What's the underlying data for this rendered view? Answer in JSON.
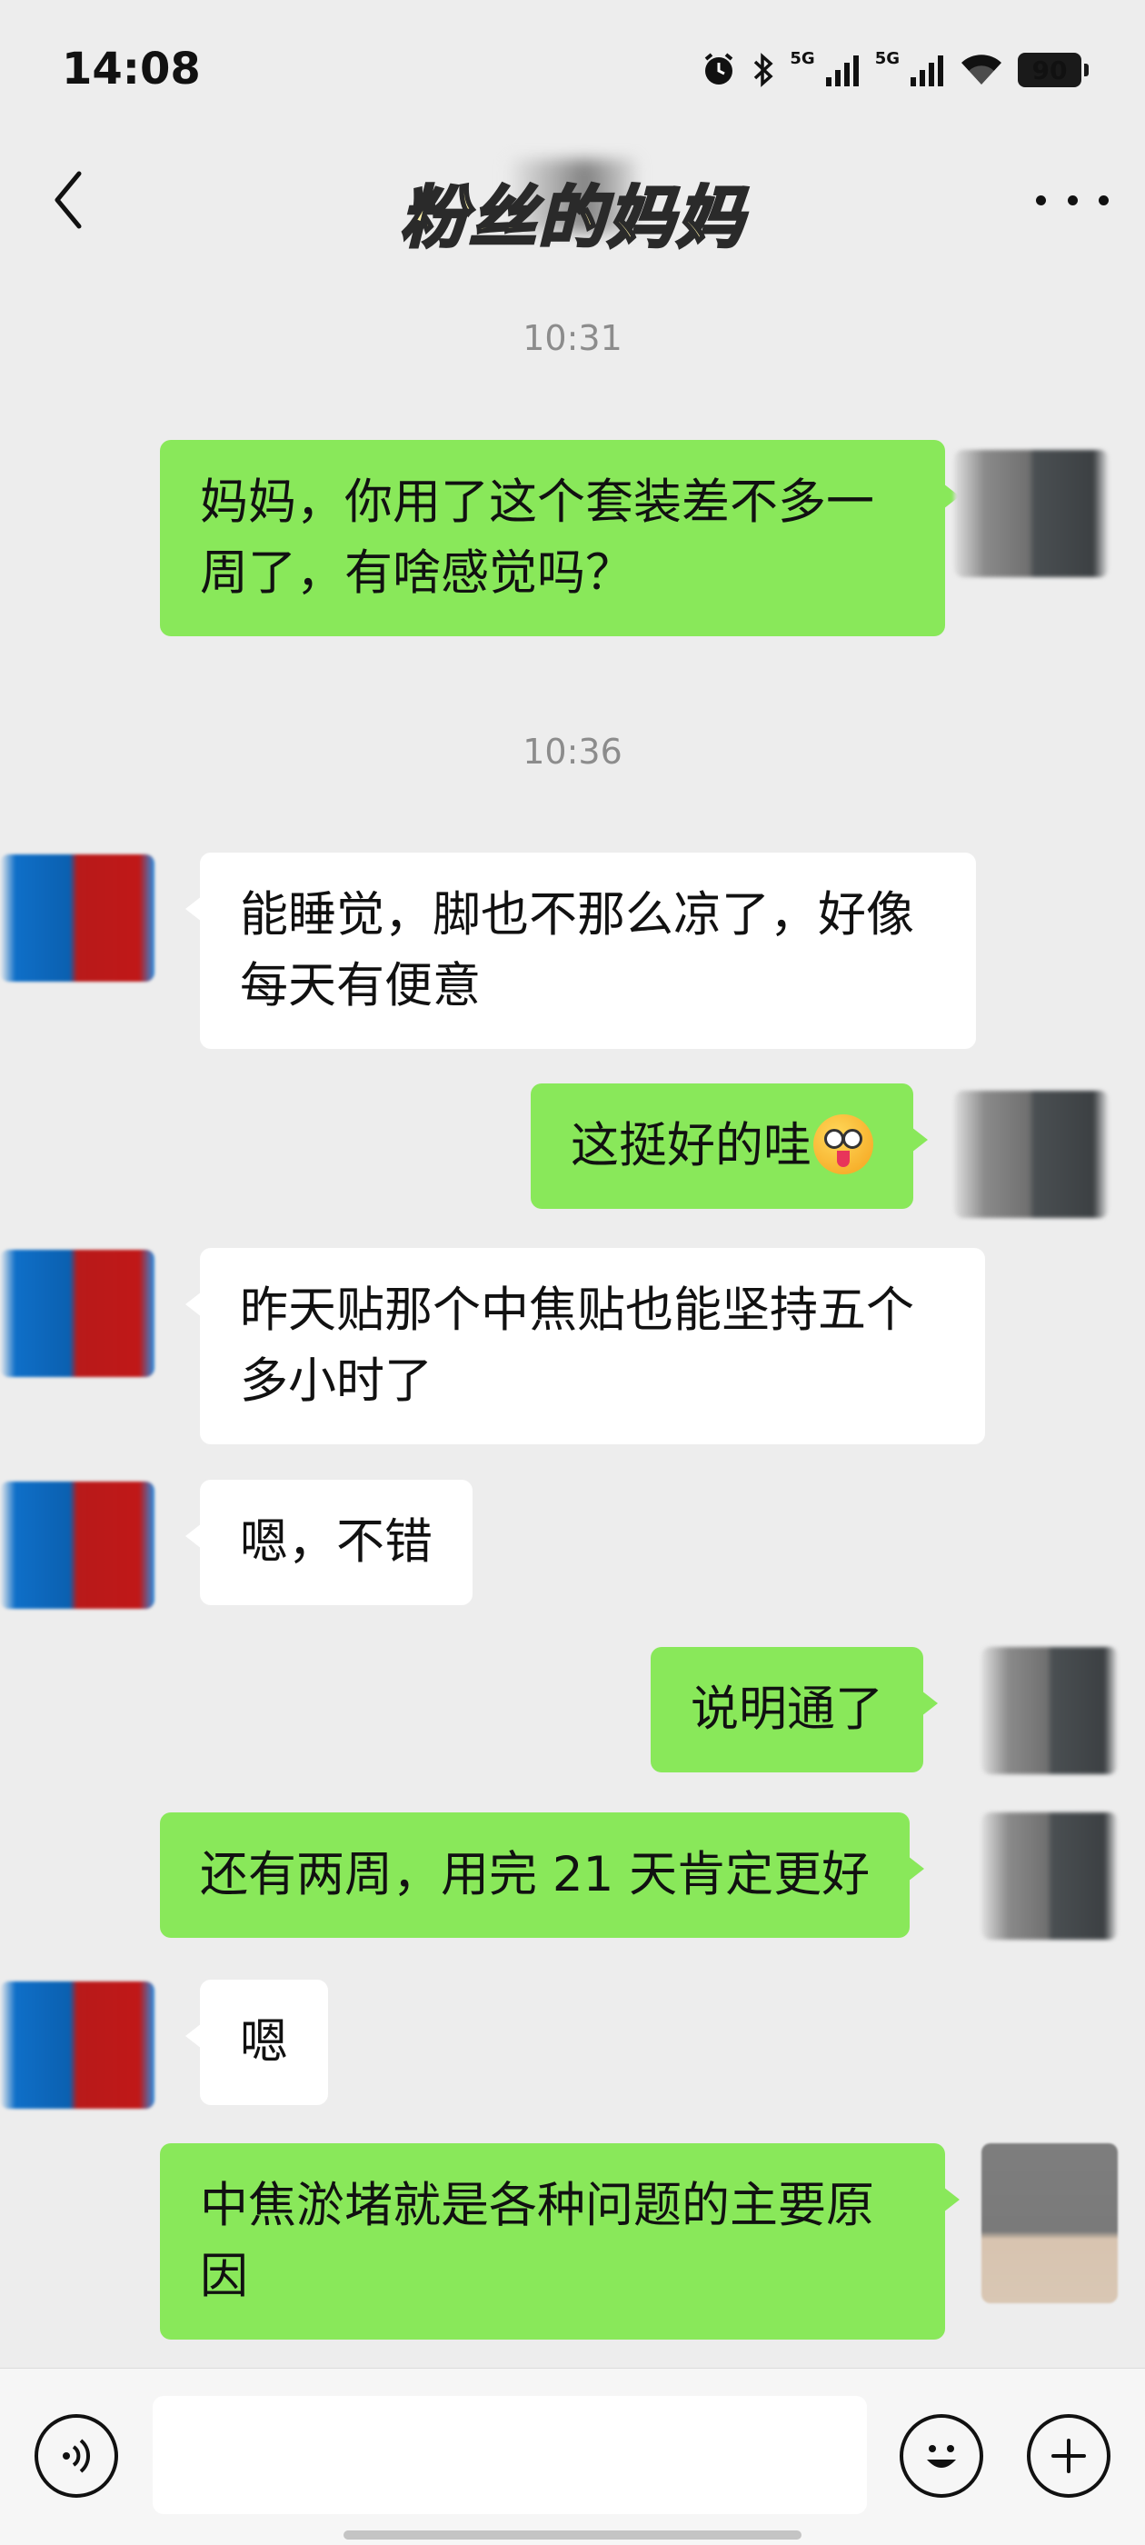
{
  "status_bar": {
    "time": "14:08",
    "network_1": "5G",
    "network_2": "5G",
    "battery": "90",
    "icons": [
      "alarm-icon",
      "bluetooth-icon",
      "signal-icon",
      "signal-icon",
      "wifi-icon",
      "battery-icon"
    ]
  },
  "nav": {
    "title": "粉丝的妈妈",
    "back_icon": "chevron-left-icon",
    "more_icon": "more-icon"
  },
  "messages": {
    "ts1": "10:31",
    "m1": "妈妈，你用了这个套装差不多一周了，有啥感觉吗？",
    "ts2": "10:36",
    "m2": "能睡觉，脚也不那么凉了，好像每天有便意",
    "m3": "这挺好的哇",
    "m4": "昨天贴那个中焦贴也能坚持五个多小时了",
    "m5": "嗯，不错",
    "m6": "说明通了",
    "m7": "还有两周，用完 21 天肯定更好",
    "m8": "嗯",
    "m9": "中焦淤堵就是各种问题的主要原因"
  },
  "input_bar": {
    "value": "",
    "icons": [
      "voice-icon",
      "emoji-icon",
      "plus-icon"
    ]
  },
  "colors": {
    "background": "#ededed",
    "sent_bubble": "#89e85a",
    "received_bubble": "#ffffff",
    "title_fill": "#fff3a8"
  }
}
